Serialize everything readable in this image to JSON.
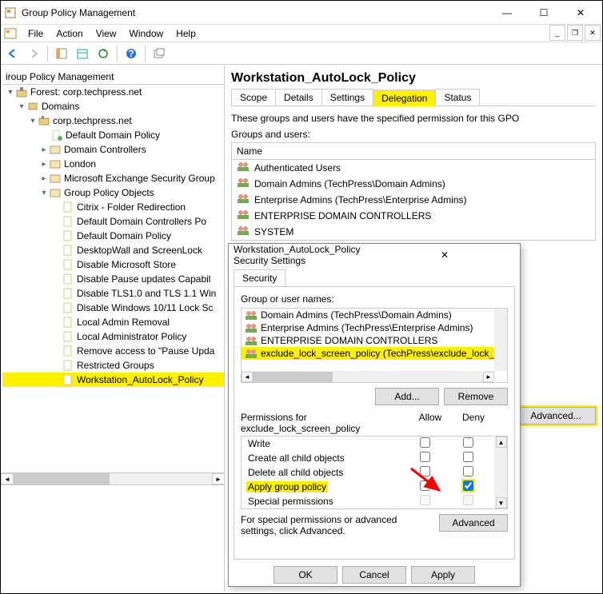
{
  "window": {
    "title": "Group Policy Management",
    "minimize": "—",
    "maximize": "☐",
    "close": "✕"
  },
  "menu": {
    "file": "File",
    "action": "Action",
    "view": "View",
    "window": "Window",
    "help": "Help"
  },
  "doc_ctrl": {
    "min": "_",
    "restore": "❐",
    "close": "✕"
  },
  "tree": {
    "header": "iroup Policy Management",
    "forest": "Forest: corp.techpress.net",
    "domains": "Domains",
    "domain": "corp.techpress.net",
    "nodes": [
      "Default Domain Policy",
      "Domain Controllers",
      "London",
      "Microsoft Exchange Security Group",
      "Group Policy Objects"
    ],
    "gpo": [
      "Citrix - Folder Redirection",
      "Default Domain Controllers Po",
      "Default Domain Policy",
      "DesktopWall and ScreenLock",
      "Disable Microsoft Store",
      "Disable Pause updates Capabil",
      "Disable TLS1.0 and TLS 1.1 Win",
      "Disable Windows 10/11 Lock Sc",
      "Local Admin Removal",
      "Local Administrator Policy",
      "Remove access to \"Pause Upda",
      "Restricted Groups",
      "Workstation_AutoLock_Policy"
    ]
  },
  "details": {
    "title": "Workstation_AutoLock_Policy",
    "tabs": [
      "Scope",
      "Details",
      "Settings",
      "Delegation",
      "Status"
    ],
    "desc": "These groups and users have the specified permission for this GPO",
    "groups_label": "Groups and users:",
    "name_col": "Name",
    "rows": [
      "Authenticated Users",
      "Domain Admins (TechPress\\Domain Admins)",
      "Enterprise Admins (TechPress\\Enterprise Admins)",
      "ENTERPRISE DOMAIN CONTROLLERS",
      "SYSTEM"
    ],
    "advanced": "Advanced..."
  },
  "dialog": {
    "title": "Workstation_AutoLock_Policy Security Settings",
    "close": "✕",
    "tab": "Security",
    "gon": "Group or user names:",
    "groups": [
      "Domain Admins (TechPress\\Domain Admins)",
      "Enterprise Admins (TechPress\\Enterprise Admins)",
      "ENTERPRISE DOMAIN CONTROLLERS",
      "exclude_lock_screen_policy (TechPress\\exclude_lock_sc"
    ],
    "add": "Add...",
    "remove": "Remove",
    "perm_for": "Permissions for exclude_lock_screen_policy",
    "allow": "Allow",
    "deny": "Deny",
    "perms": [
      "Write",
      "Create all child objects",
      "Delete all child objects",
      "Apply group policy",
      "Special permissions"
    ],
    "note": "For special permissions or advanced settings, click Advanced.",
    "adv": "Advanced",
    "ok": "OK",
    "cancel": "Cancel",
    "apply": "Apply"
  }
}
